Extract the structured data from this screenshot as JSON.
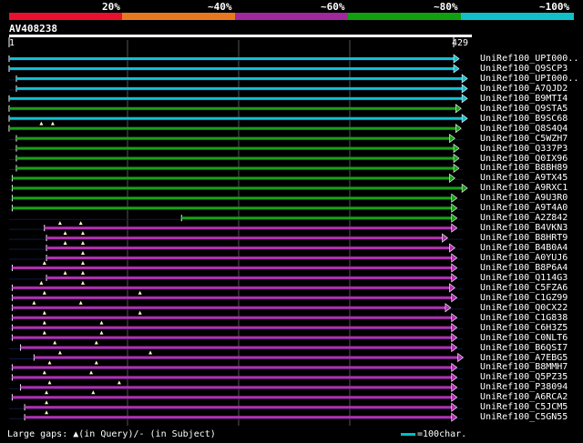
{
  "scale": {
    "labels": [
      "20%",
      "~40%",
      "~60%",
      "~80%",
      "~100%"
    ],
    "colors": [
      "#e8102e",
      "#e87820",
      "#a0289c",
      "#10a010",
      "#10c0c8"
    ]
  },
  "query": {
    "name": "AV408238",
    "start": "1",
    "end": "429",
    "length": 429
  },
  "chart_data": {
    "type": "alignment",
    "query_length": 429,
    "hits": [
      {
        "name": "UniRef100_UPI000..",
        "start": 1,
        "end": 429,
        "identity_class": "~100%"
      },
      {
        "name": "UniRef100_Q9SCP3",
        "start": 1,
        "end": 429,
        "identity_class": "~100%"
      },
      {
        "name": "UniRef100_UPI000..",
        "start": 8,
        "end": 437,
        "identity_class": "~100%"
      },
      {
        "name": "UniRef100_A7QJD2",
        "start": 8,
        "end": 437,
        "identity_class": "~100%"
      },
      {
        "name": "UniRef100_B9MTI4",
        "start": 1,
        "end": 437,
        "identity_class": "~100%"
      },
      {
        "name": "UniRef100_Q9STA5",
        "start": 1,
        "end": 431,
        "identity_class": "~80%"
      },
      {
        "name": "UniRef100_B9SC68",
        "start": 1,
        "end": 437,
        "identity_class": "~100%"
      },
      {
        "name": "UniRef100_Q8S4Q4",
        "start": 1,
        "end": 431,
        "identity_class": "~80%",
        "gaps": [
          32,
          43
        ]
      },
      {
        "name": "UniRef100_C5WZH7",
        "start": 8,
        "end": 425,
        "identity_class": "~80%"
      },
      {
        "name": "UniRef100_Q337P3",
        "start": 8,
        "end": 429,
        "identity_class": "~80%"
      },
      {
        "name": "UniRef100_Q0IX96",
        "start": 8,
        "end": 429,
        "identity_class": "~80%"
      },
      {
        "name": "UniRef100_B8BH89",
        "start": 8,
        "end": 429,
        "identity_class": "~80%"
      },
      {
        "name": "UniRef100_A9TX45",
        "start": 4,
        "end": 425,
        "identity_class": "~80%"
      },
      {
        "name": "UniRef100_A9RXC1",
        "start": 4,
        "end": 437,
        "identity_class": "~80%"
      },
      {
        "name": "UniRef100_A9U3R0",
        "start": 4,
        "end": 427,
        "identity_class": "~80%"
      },
      {
        "name": "UniRef100_A9T4A0",
        "start": 4,
        "end": 427,
        "identity_class": "~80%"
      },
      {
        "name": "UniRef100_A2Z842",
        "start": 167,
        "end": 427,
        "identity_class": "~80%"
      },
      {
        "name": "UniRef100_B4VKN3",
        "start": 35,
        "end": 427,
        "identity_class": "~60%",
        "gaps": [
          50,
          70
        ]
      },
      {
        "name": "UniRef100_B8HRT9",
        "start": 37,
        "end": 418,
        "identity_class": "~60%",
        "gaps": [
          55,
          72
        ]
      },
      {
        "name": "UniRef100_B4B0A4",
        "start": 37,
        "end": 425,
        "identity_class": "~60%",
        "gaps": [
          55,
          72
        ]
      },
      {
        "name": "UniRef100_A0YUJ6",
        "start": 37,
        "end": 427,
        "identity_class": "~60%",
        "gaps": [
          72
        ]
      },
      {
        "name": "UniRef100_B8P6A4",
        "start": 4,
        "end": 427,
        "identity_class": "~60%",
        "gaps": [
          35,
          72
        ]
      },
      {
        "name": "UniRef100_Q114G3",
        "start": 37,
        "end": 427,
        "identity_class": "~60%",
        "gaps": [
          55,
          72
        ]
      },
      {
        "name": "UniRef100_C5FZA6",
        "start": 4,
        "end": 425,
        "identity_class": "~60%",
        "gaps": [
          32,
          72
        ]
      },
      {
        "name": "UniRef100_C1GZ99",
        "start": 4,
        "end": 427,
        "identity_class": "~60%",
        "gaps": [
          35,
          127
        ]
      },
      {
        "name": "UniRef100_Q0CX22",
        "start": 4,
        "end": 421,
        "identity_class": "~60%",
        "gaps": [
          25,
          70
        ]
      },
      {
        "name": "UniRef100_C1G838",
        "start": 4,
        "end": 427,
        "identity_class": "~60%",
        "gaps": [
          35,
          127
        ]
      },
      {
        "name": "UniRef100_C6H3Z5",
        "start": 4,
        "end": 427,
        "identity_class": "~60%",
        "gaps": [
          35,
          90
        ]
      },
      {
        "name": "UniRef100_C0NLT6",
        "start": 4,
        "end": 427,
        "identity_class": "~60%",
        "gaps": [
          35,
          90
        ]
      },
      {
        "name": "UniRef100_B6QSI7",
        "start": 12,
        "end": 427,
        "identity_class": "~60%",
        "gaps": [
          45,
          85
        ]
      },
      {
        "name": "UniRef100_A7EBG5",
        "start": 25,
        "end": 433,
        "identity_class": "~60%",
        "gaps": [
          50,
          137
        ]
      },
      {
        "name": "UniRef100_B8MMH7",
        "start": 4,
        "end": 427,
        "identity_class": "~60%",
        "gaps": [
          40,
          85
        ]
      },
      {
        "name": "UniRef100_Q5PZ35",
        "start": 4,
        "end": 427,
        "identity_class": "~60%",
        "gaps": [
          35,
          80
        ]
      },
      {
        "name": "UniRef100_P38094",
        "start": 12,
        "end": 427,
        "identity_class": "~60%",
        "gaps": [
          40,
          107
        ]
      },
      {
        "name": "UniRef100_A6RCA2",
        "start": 4,
        "end": 427,
        "identity_class": "~60%",
        "gaps": [
          37,
          82
        ]
      },
      {
        "name": "UniRef100_C5JCM5",
        "start": 16,
        "end": 427,
        "identity_class": "~60%",
        "gaps": [
          37
        ]
      },
      {
        "name": "UniRef100_C5GN55",
        "start": 16,
        "end": 427,
        "identity_class": "~60%",
        "gaps": [
          37
        ]
      }
    ]
  },
  "legend": {
    "gaps_text": "Large gaps: ▲(in Query)/- (in Subject)",
    "scale_text": "=100char."
  }
}
